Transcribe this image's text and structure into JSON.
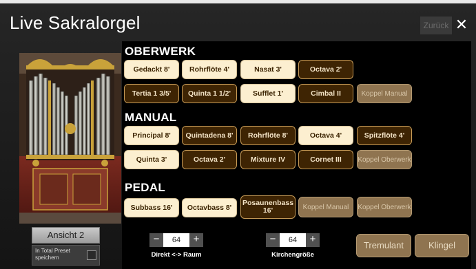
{
  "window": {
    "title": "Live Sakralorgel",
    "back_label": "Zurück",
    "close_label": "✕"
  },
  "left": {
    "view_label": "Ansicht 2",
    "preset_label": "In Total Preset speichern"
  },
  "sections": {
    "oberwerk": "OBERWERK",
    "manual": "MANUAL",
    "pedal": "PEDAL"
  },
  "stops": {
    "oberwerk": [
      {
        "label": "Gedackt 8'",
        "state": "on"
      },
      {
        "label": "Rohrflöte 4'",
        "state": "on"
      },
      {
        "label": "Nasat 3'",
        "state": "on"
      },
      {
        "label": "Octava 2'",
        "state": "off"
      },
      {
        "label": "Tertia 1 3/5'",
        "state": "off"
      },
      {
        "label": "Quinta 1 1/2'",
        "state": "off"
      },
      {
        "label": "Sufflet 1'",
        "state": "on"
      },
      {
        "label": "Cimbal II",
        "state": "off"
      },
      {
        "label": "Koppel Manual",
        "state": "coupler"
      }
    ],
    "manual": [
      {
        "label": "Principal 8'",
        "state": "on"
      },
      {
        "label": "Quintadena 8'",
        "state": "off"
      },
      {
        "label": "Rohrflöte 8'",
        "state": "off"
      },
      {
        "label": "Octava 4'",
        "state": "on"
      },
      {
        "label": "Spitzflöte 4'",
        "state": "off"
      },
      {
        "label": "Quinta 3'",
        "state": "on"
      },
      {
        "label": "Octava 2'",
        "state": "off"
      },
      {
        "label": "Mixture IV",
        "state": "off"
      },
      {
        "label": "Cornet III",
        "state": "off"
      },
      {
        "label": "Koppel Oberwerk",
        "state": "coupler"
      }
    ],
    "pedal": [
      {
        "label": "Subbass 16'",
        "state": "on"
      },
      {
        "label": "Octavbass 8'",
        "state": "on"
      },
      {
        "label": "Posaunenbass 16'",
        "state": "off"
      },
      {
        "label": "Koppel Manual",
        "state": "coupler"
      },
      {
        "label": "Koppel Oberwerk",
        "state": "coupler"
      }
    ]
  },
  "controls": {
    "direkt_raum": {
      "minus": "−",
      "value": "64",
      "plus": "+",
      "label": "Direkt <-> Raum"
    },
    "kirchengroesse": {
      "minus": "−",
      "value": "64",
      "plus": "+",
      "label": "Kirchengröße"
    },
    "tremulant_label": "Tremulant",
    "klingel_label": "Klingel"
  },
  "colors": {
    "stop_on": "#fcefd0",
    "stop_off": "#3e2403",
    "coupler": "#8f7450"
  }
}
